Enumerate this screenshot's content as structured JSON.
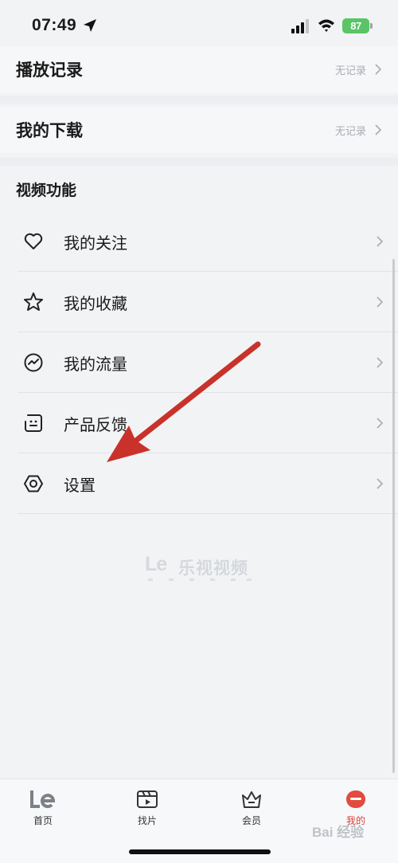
{
  "status": {
    "time": "07:49",
    "battery": "87"
  },
  "history": {
    "label": "播放记录",
    "meta": "无记录"
  },
  "downloads": {
    "label": "我的下载",
    "meta": "无记录"
  },
  "functions": {
    "header": "视频功能",
    "items": [
      {
        "label": "我的关注",
        "icon": "heart-icon"
      },
      {
        "label": "我的收藏",
        "icon": "star-icon"
      },
      {
        "label": "我的流量",
        "icon": "traffic-icon"
      },
      {
        "label": "产品反馈",
        "icon": "feedback-icon"
      },
      {
        "label": "设置",
        "icon": "settings-icon"
      }
    ]
  },
  "watermark": {
    "logo": "Le",
    "brand": "乐视视频"
  },
  "tabs": [
    {
      "label": "首页",
      "icon": "le-logo-icon"
    },
    {
      "label": "找片",
      "icon": "clapper-icon"
    },
    {
      "label": "会员",
      "icon": "crown-icon"
    },
    {
      "label": "我的",
      "icon": "profile-icon",
      "active": true
    }
  ],
  "overlay_watermark": "Bai 经验",
  "colors": {
    "accent": "#d6453a",
    "annotation_arrow": "#c8322a",
    "battery": "#5ac466"
  }
}
